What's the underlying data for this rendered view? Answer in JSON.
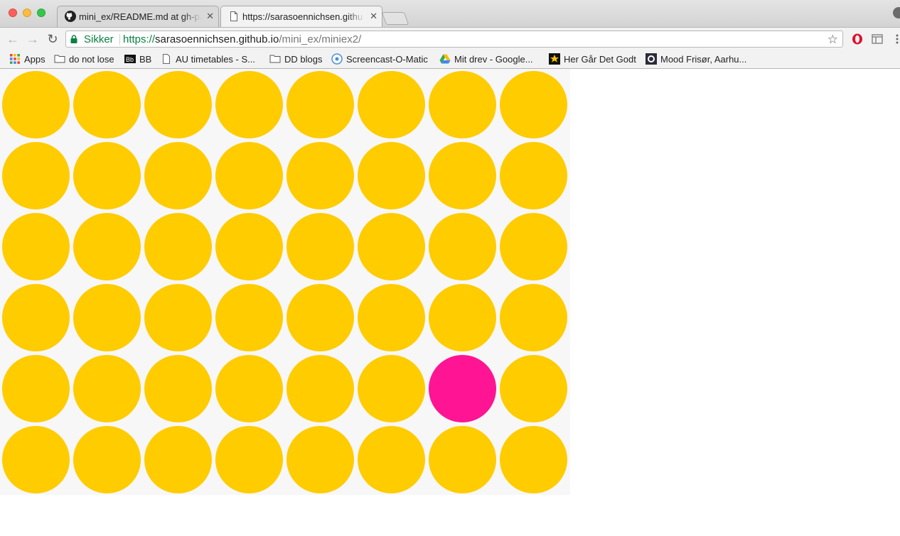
{
  "window": {
    "tabs": [
      {
        "title": "mini_ex/README.md at gh-pa",
        "icon": "github-icon",
        "active": false
      },
      {
        "title": "https://sarasoennichsen.githu",
        "icon": "page-icon",
        "active": true
      }
    ]
  },
  "toolbar": {
    "secure_label": "Sikker",
    "url_scheme": "https://",
    "url_host": "sarasoennichsen.github.io",
    "url_path": "/mini_ex/miniex2/"
  },
  "bookmarks": [
    {
      "label": "Apps",
      "icon": "apps-grid-icon"
    },
    {
      "label": "do not lose",
      "icon": "folder-icon"
    },
    {
      "label": "BB",
      "icon": "blackboard-icon"
    },
    {
      "label": "AU timetables - S...",
      "icon": "page-icon"
    },
    {
      "label": "DD blogs",
      "icon": "folder-icon"
    },
    {
      "label": "Screencast-O-Matic",
      "icon": "screencast-icon"
    },
    {
      "label": "Mit drev - Google...",
      "icon": "google-drive-icon"
    },
    {
      "label": "Her Går Det Godt",
      "icon": "star-icon"
    },
    {
      "label": "Mood Frisør, Aarhu...",
      "icon": "mood-icon"
    }
  ],
  "sketch": {
    "rows": 6,
    "cols": 8,
    "circle_color": "#ffcc00",
    "highlight_color": "#ff1493",
    "highlight": {
      "row": 4,
      "col": 6
    },
    "background_color": "#f7f7f7"
  }
}
